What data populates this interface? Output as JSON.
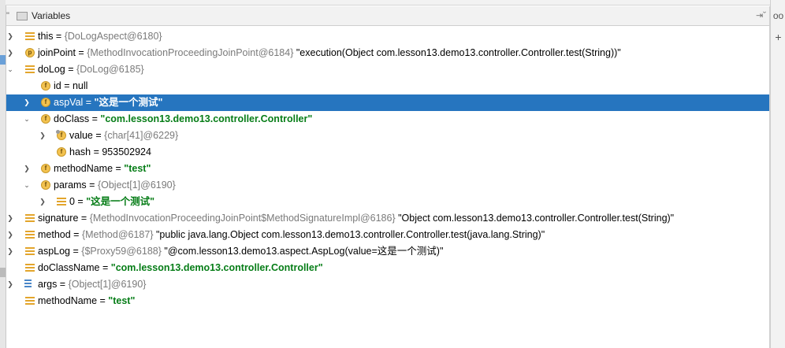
{
  "panel": {
    "title": "Variables",
    "dots": "\"",
    "pin": "⇥˘"
  },
  "right_bar": {
    "glasses": "oo",
    "add": "+"
  },
  "rows": [
    {
      "name": "this",
      "sep": " = ",
      "ref": "{DoLogAspect@6180}",
      "val": ""
    },
    {
      "name": "joinPoint",
      "sep": " = ",
      "ref": "{MethodInvocationProceedingJoinPoint@6184}",
      "val": " \"execution(Object com.lesson13.demo13.controller.Controller.test(String))\""
    },
    {
      "name": "doLog",
      "sep": " = ",
      "ref": "{DoLog@6185}",
      "val": ""
    },
    {
      "name": "id",
      "sep": " = ",
      "ref": "",
      "val": "null"
    },
    {
      "name": "aspVal",
      "sep": " = ",
      "ref": "",
      "val": "\"这是一个测试\""
    },
    {
      "name": "doClass",
      "sep": " = ",
      "ref": "",
      "val": "\"com.lesson13.demo13.controller.Controller\""
    },
    {
      "name": "value",
      "sep": " = ",
      "ref": "{char[41]@6229}",
      "val": ""
    },
    {
      "name": "hash",
      "sep": " = ",
      "ref": "",
      "val": "953502924"
    },
    {
      "name": "methodName",
      "sep": " = ",
      "ref": "",
      "val": "\"test\""
    },
    {
      "name": "params",
      "sep": " = ",
      "ref": "{Object[1]@6190}",
      "val": ""
    },
    {
      "name": "0",
      "sep": " = ",
      "ref": "",
      "val": "\"这是一个测试\""
    },
    {
      "name": "signature",
      "sep": " = ",
      "ref": "{MethodInvocationProceedingJoinPoint$MethodSignatureImpl@6186}",
      "val": " \"Object com.lesson13.demo13.controller.Controller.test(String)\""
    },
    {
      "name": "method",
      "sep": " = ",
      "ref": "{Method@6187}",
      "val": " \"public java.lang.Object com.lesson13.demo13.controller.Controller.test(java.lang.String)\""
    },
    {
      "name": "aspLog",
      "sep": " = ",
      "ref": "{$Proxy59@6188}",
      "val": " \"@com.lesson13.demo13.aspect.AspLog(value=这是一个测试)\""
    },
    {
      "name": "doClassName",
      "sep": " = ",
      "ref": "",
      "val": "\"com.lesson13.demo13.controller.Controller\""
    },
    {
      "name": "args",
      "sep": " = ",
      "ref": "{Object[1]@6190}",
      "val": ""
    },
    {
      "name": "methodName",
      "sep": " = ",
      "ref": "",
      "val": "\"test\""
    }
  ],
  "icon_letters": {
    "field": "f",
    "param": "p"
  },
  "colors": {
    "selection": "#2675bf",
    "string": "#067d17",
    "reference": "#7a7a7a"
  }
}
